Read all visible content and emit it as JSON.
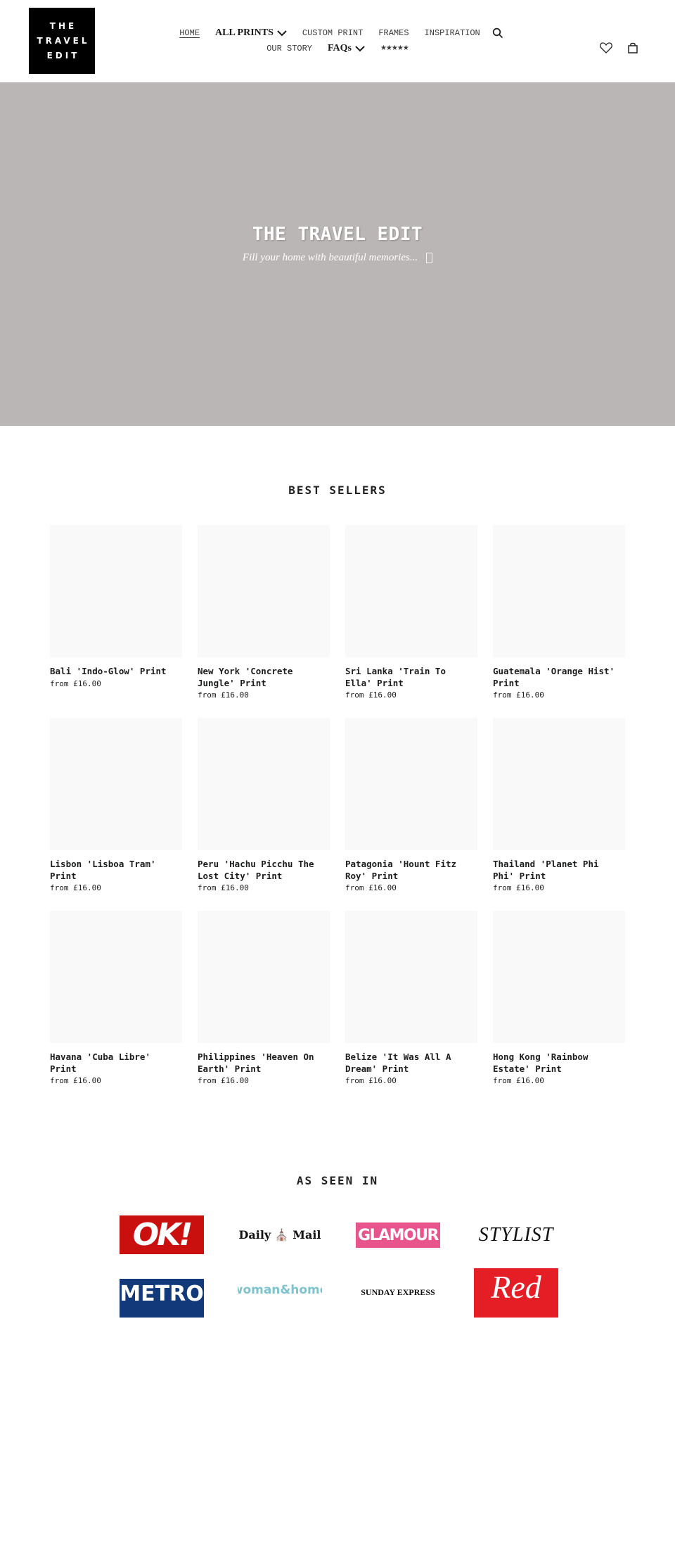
{
  "header": {
    "logo_lines": [
      "THE",
      "TRAVEL",
      "EDIT"
    ],
    "nav_row1": [
      {
        "label": "HOME",
        "active": true
      },
      {
        "label": "ALL PRINTS",
        "dropdown": true
      },
      {
        "label": "CUSTOM PRINT"
      },
      {
        "label": "FRAMES"
      },
      {
        "label": "INSPIRATION"
      }
    ],
    "nav_row2": [
      {
        "label": "OUR STORY"
      },
      {
        "label": "FAQs",
        "dropdown": true
      },
      {
        "label": "★★★★★"
      }
    ],
    "icons": [
      "search-icon",
      "heart-icon",
      "bag-icon"
    ]
  },
  "hero": {
    "title": "THE TRAVEL EDIT",
    "subtitle": "Fill your home with beautiful memories...",
    "background": "#bbb6b6"
  },
  "best_sellers": {
    "title": "BEST SELLERS",
    "products": [
      {
        "title": "Bali 'Indo-Glow' Print",
        "price": "from £16.00"
      },
      {
        "title": "New York 'Concrete Jungle' Print",
        "price": "from £16.00"
      },
      {
        "title": "Sri Lanka 'Train To Ella' Print",
        "price": "from £16.00"
      },
      {
        "title": "Guatemala 'Orange Hist' Print",
        "price": "from £16.00"
      },
      {
        "title": "Lisbon 'Lisboa Tram' Print",
        "price": "from £16.00"
      },
      {
        "title": "Peru 'Hachu Picchu The Lost City' Print",
        "price": "from £16.00"
      },
      {
        "title": "Patagonia 'Hount Fitz Roy' Print",
        "price": "from £16.00"
      },
      {
        "title": "Thailand 'Planet Phi Phi' Print",
        "price": "from £16.00"
      },
      {
        "title": "Havana 'Cuba Libre' Print",
        "price": "from £16.00"
      },
      {
        "title": "Philippines 'Heaven On Earth' Print",
        "price": "from £16.00"
      },
      {
        "title": "Belize 'It Was All A Dream' Print",
        "price": "from £16.00"
      },
      {
        "title": "Hong Kong 'Rainbow Estate' Print",
        "price": "from £16.00"
      }
    ]
  },
  "as_seen_in": {
    "title": "AS SEEN IN",
    "logos": [
      {
        "name": "OK!",
        "text": "OK!",
        "color": "#c9100f"
      },
      {
        "name": "Daily Mail",
        "text": "Daily ⛪ Mail"
      },
      {
        "name": "Glamour",
        "text": "GLAMOUR",
        "color": "#e8548c"
      },
      {
        "name": "Stylist",
        "text": "STYLIST"
      },
      {
        "name": "Metro",
        "text": "METRO",
        "color": "#123a7b"
      },
      {
        "name": "Woman & Home",
        "text": "woman&home",
        "color": "#7ec3d1"
      },
      {
        "name": "Sunday Express",
        "text": "SUNDAY EXPRESS"
      },
      {
        "name": "Red",
        "text": "Red",
        "color": "#e51e25"
      }
    ]
  }
}
